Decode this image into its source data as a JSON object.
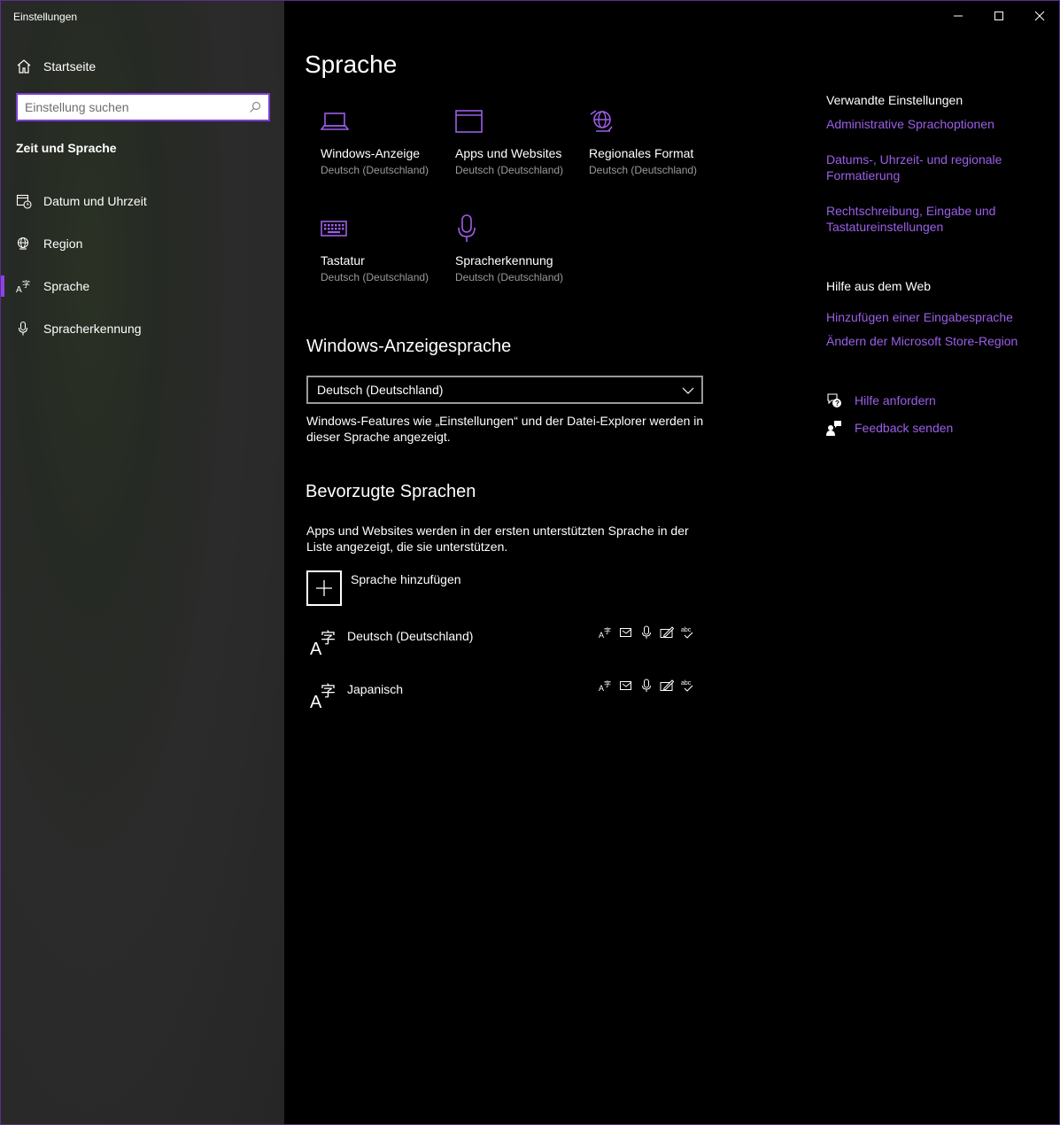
{
  "window": {
    "app_title": "Einstellungen",
    "controls": [
      "minimize-icon",
      "maximize-icon",
      "close-icon"
    ]
  },
  "sidebar": {
    "home_label": "Startseite",
    "search_placeholder": "Einstellung suchen",
    "section_title": "Zeit und Sprache",
    "items": [
      {
        "label": "Datum und Uhrzeit",
        "icon": "calendar-clock-icon",
        "active": false
      },
      {
        "label": "Region",
        "icon": "globe-icon",
        "active": false
      },
      {
        "label": "Sprache",
        "icon": "language-icon",
        "active": true
      },
      {
        "label": "Spracherkennung",
        "icon": "microphone-icon",
        "active": false
      }
    ]
  },
  "main": {
    "title": "Sprache",
    "tiles": [
      {
        "name": "Windows-Anzeige",
        "sub": "Deutsch (Deutschland)",
        "icon": "laptop-icon"
      },
      {
        "name": "Apps und Websites",
        "sub": "Deutsch (Deutschland)",
        "icon": "browser-window-icon"
      },
      {
        "name": "Regionales Format",
        "sub": "Deutsch (Deutschland)",
        "icon": "globe-format-icon"
      },
      {
        "name": "Tastatur",
        "sub": "Deutsch (Deutschland)",
        "icon": "keyboard-icon"
      },
      {
        "name": "Spracherkennung",
        "sub": "Deutsch (Deutschland)",
        "icon": "microphone-icon"
      }
    ],
    "display_language": {
      "heading": "Windows-Anzeigesprache",
      "selected": "Deutsch (Deutschland)",
      "description": "Windows-Features wie „Einstellungen“ und der Datei-Explorer werden in dieser Sprache angezeigt."
    },
    "preferred": {
      "heading": "Bevorzugte Sprachen",
      "description": "Apps und Websites werden in der ersten unterstützten Sprache in der Liste angezeigt, die sie unterstützen.",
      "add_label": "Sprache hinzufügen",
      "languages": [
        {
          "name": "Deutsch (Deutschland)"
        },
        {
          "name": "Japanisch"
        }
      ],
      "feature_icons": [
        "display-language-icon",
        "text-to-speech-icon",
        "speech-recognition-icon",
        "handwriting-icon",
        "spellcheck-icon"
      ]
    }
  },
  "right": {
    "related_heading": "Verwandte Einstellungen",
    "related_links": [
      "Administrative Sprachoptionen",
      "Datums-, Uhrzeit- und regionale Formatierung",
      "Rechtschreibung, Eingabe und Tastatureinstellungen"
    ],
    "help_heading": "Hilfe aus dem Web",
    "help_links": [
      "Hinzufügen einer Eingabesprache",
      "Ändern der Microsoft Store-Region"
    ],
    "get_help": "Hilfe anfordern",
    "feedback": "Feedback senden"
  },
  "colors": {
    "accent": "#9b5fe8",
    "sidebar_bg": "#2b2b2b",
    "main_bg": "#000000",
    "subtext": "#9a9a9a"
  }
}
